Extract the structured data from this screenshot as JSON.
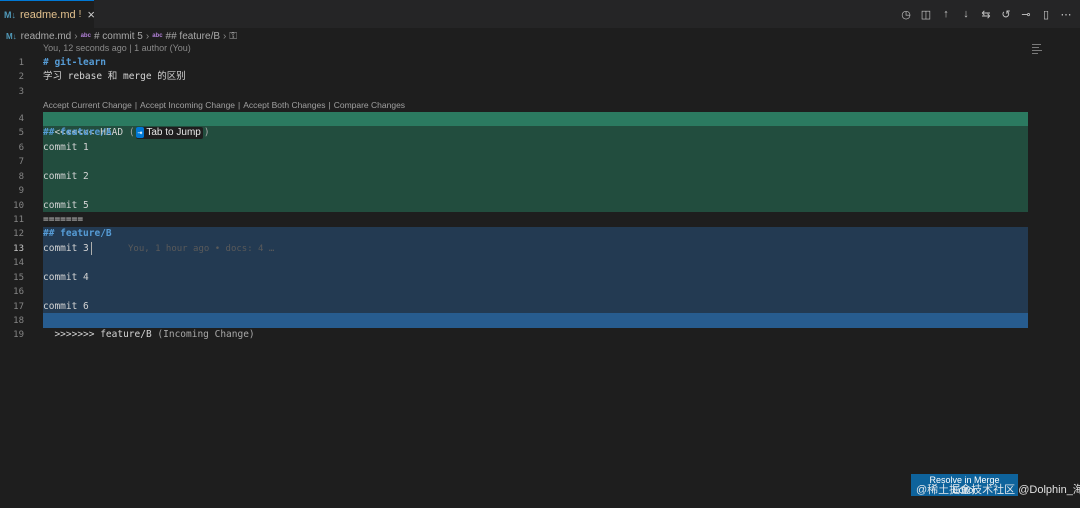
{
  "tab": {
    "title": "readme.md",
    "modified_marker": "!",
    "close_glyph": "×",
    "file_icon": "M↓"
  },
  "editor_actions": [
    {
      "name": "timeline-icon",
      "glyph": "◷"
    },
    {
      "name": "open-changes-icon",
      "glyph": "◫"
    },
    {
      "name": "previous-conflict-icon",
      "glyph": "↑"
    },
    {
      "name": "next-conflict-icon",
      "glyph": "↓"
    },
    {
      "name": "source-control-icon",
      "glyph": "⇆"
    },
    {
      "name": "go-back-icon",
      "glyph": "↺"
    },
    {
      "name": "commit-node-icon",
      "glyph": "⊸"
    },
    {
      "name": "split-editor-icon",
      "glyph": "▯"
    },
    {
      "name": "more-actions-icon",
      "glyph": "⋯"
    }
  ],
  "breadcrumb": {
    "file": "readme.md",
    "items": [
      "# commit 5",
      "## feature/B"
    ],
    "symbol_glyph": "abc"
  },
  "blame_header": "You, 12 seconds ago | 1 author (You)",
  "codelens": {
    "accept_current": "Accept Current Change",
    "accept_incoming": "Accept Incoming Change",
    "accept_both": "Accept Both Changes",
    "compare": "Compare Changes",
    "separator": "|"
  },
  "line_numbers": [
    "1",
    "2",
    "3",
    "4",
    "5",
    "6",
    "7",
    "8",
    "9",
    "10",
    "11",
    "12",
    "13",
    "14",
    "15",
    "16",
    "17",
    "18",
    "19"
  ],
  "active_line": "13",
  "lines": {
    "l1": "# git-learn",
    "l2": "学习 rebase 和 merge 的区别",
    "l4_marker": "<<<<<<< HEAD ",
    "l4_open": "(",
    "l4_close": ")",
    "l5": "## feature/A",
    "l6": "commit 1",
    "l8": "commit 2",
    "l10": "commit 5",
    "l11": "=======",
    "l12": "## feature/B",
    "l13": "commit 3",
    "l15": "commit 4",
    "l17": "commit 6",
    "l18_marker": ">>>>>>> feature/B ",
    "l18_label": "(Incoming Change)"
  },
  "tab_to_jump": {
    "icon": "⇥",
    "label": "Tab to Jump"
  },
  "inline_blame": "You, 1 hour ago • docs: 4 …",
  "resolve_button": "Resolve in Merge Editor",
  "watermark": "@稀土掘金技术社区 @Dolphin_海豚",
  "colors": {
    "current_header": "#2b7a60",
    "current_body": "#224d3e",
    "incoming_body": "#233a52",
    "incoming_header": "#275c8f",
    "accent": "#0078d4"
  }
}
